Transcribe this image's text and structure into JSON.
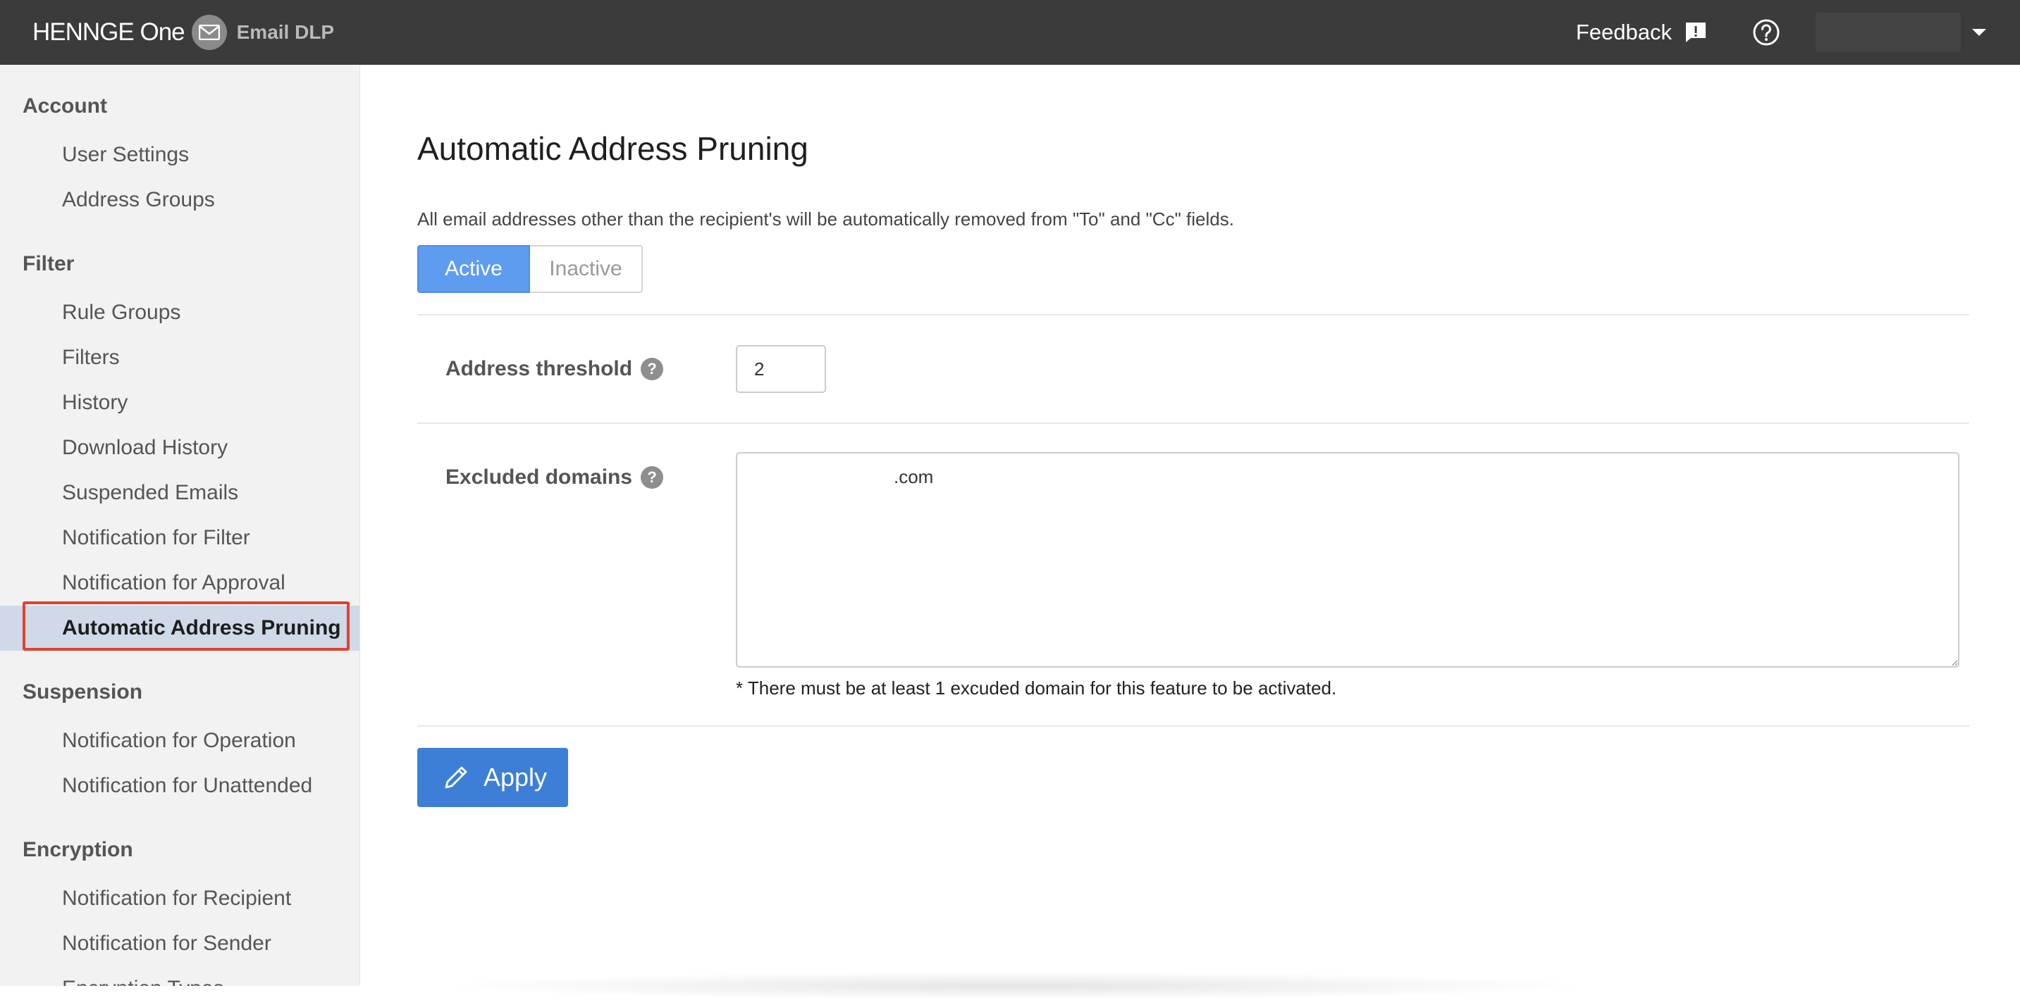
{
  "header": {
    "brand": "HENNGE One",
    "product": "Email DLP",
    "feedback_label": "Feedback",
    "user_name": ""
  },
  "sidebar": {
    "sections": [
      {
        "title": "Account",
        "items": [
          "User Settings",
          "Address Groups"
        ]
      },
      {
        "title": "Filter",
        "items": [
          "Rule Groups",
          "Filters",
          "History",
          "Download History",
          "Suspended Emails",
          "Notification for Filter",
          "Notification for Approval",
          "Automatic Address Pruning"
        ]
      },
      {
        "title": "Suspension",
        "items": [
          "Notification for Operation",
          "Notification for Unattended"
        ]
      },
      {
        "title": "Encryption",
        "items": [
          "Notification for Recipient",
          "Notification for Sender",
          "Encryption Types"
        ]
      }
    ],
    "active_item": "Automatic Address Pruning"
  },
  "main": {
    "title": "Automatic Address Pruning",
    "description": "All email addresses other than the recipient's will be automatically removed from \"To\" and \"Cc\" fields.",
    "status_toggle": {
      "active_label": "Active",
      "inactive_label": "Inactive",
      "selected": "Active"
    },
    "address_threshold": {
      "label": "Address threshold",
      "help": "?",
      "value": "2"
    },
    "excluded_domains": {
      "label": "Excluded domains",
      "help": "?",
      "value": ".com",
      "note": "* There must be at least 1 excuded domain for this feature to be activated."
    },
    "apply_label": "Apply"
  },
  "colors": {
    "header_bg": "#3b3b3b",
    "sidebar_bg": "#f2f2f2",
    "active_item_bg": "#cfd9e8",
    "highlight_outline": "#e0412f",
    "toggle_active": "#5e9cf0",
    "apply_button": "#3d7fd6"
  },
  "icons": {
    "brand": "mail-envelope-icon",
    "feedback": "feedback-icon",
    "help": "help-circle-icon",
    "user_menu": "caret-down-icon",
    "field_help": "question-mark-icon",
    "apply": "pencil-icon"
  }
}
